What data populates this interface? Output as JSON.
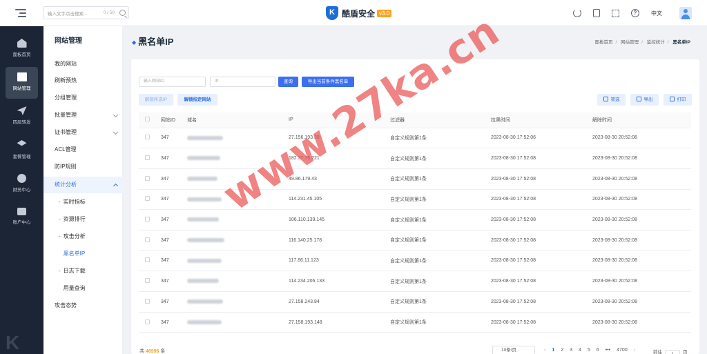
{
  "header": {
    "search_placeholder": "输入文字点击搜索...",
    "search_count": "0 / 50",
    "brand_name": "酷盾安全",
    "brand_version": "v3.0",
    "lang": "中文"
  },
  "rail": [
    {
      "label": "面板首页",
      "icon": "home-icon"
    },
    {
      "label": "网站管理",
      "icon": "site-icon"
    },
    {
      "label": "四层转发",
      "icon": "send-icon"
    },
    {
      "label": "套餐管理",
      "icon": "layers-icon"
    },
    {
      "label": "财务中心",
      "icon": "coin-icon"
    },
    {
      "label": "账户中心",
      "icon": "user-icon"
    }
  ],
  "submenu": {
    "title": "网站管理",
    "items": [
      {
        "label": "我的网站"
      },
      {
        "label": "刷新预热"
      },
      {
        "label": "分组管理"
      },
      {
        "label": "批量管理"
      },
      {
        "label": "证书管理"
      },
      {
        "label": "ACL管理"
      },
      {
        "label": "防IP规则"
      },
      {
        "label": "统计分析"
      },
      {
        "label": "实时指标"
      },
      {
        "label": "资源排行"
      },
      {
        "label": "攻击分析"
      },
      {
        "label": "黑名单IP"
      },
      {
        "label": "日志下载"
      },
      {
        "label": "用量查询"
      },
      {
        "label": "攻击态势"
      }
    ]
  },
  "page": {
    "title": "黑名单IP",
    "breadcrumb": [
      "面板首页",
      "网站管理",
      "监控统计",
      "黑名单IP"
    ]
  },
  "filters": {
    "site_id_placeholder": "输入网站ID",
    "ip_placeholder": "IP",
    "query_label": "查询",
    "export_label": "导出当前条件黑名单",
    "unblock_selected": "解锁所选IP",
    "unblock_site": "解锁指定网站",
    "filter_label": "筛选",
    "export_btn": "导出",
    "print_btn": "打印"
  },
  "table": {
    "columns": [
      "网站ID",
      "域名",
      "IP",
      "过滤器",
      "拉黑时间",
      "解除时间"
    ],
    "rows": [
      {
        "site_id": "347",
        "ip": "27.156.193.38",
        "filter": "自定义规则第1条",
        "blocked": "2023-08-30 17:52:06",
        "released": "2023-08-30 20:52:08"
      },
      {
        "site_id": "347",
        "ip": "182.37.78.221",
        "filter": "自定义规则第1条",
        "blocked": "2023-08-30 17:52:08",
        "released": "2023-08-30 20:52:08"
      },
      {
        "site_id": "347",
        "ip": "49.86.179.43",
        "filter": "自定义规则第1条",
        "blocked": "2023-08-30 17:52:08",
        "released": "2023-08-30 20:52:08"
      },
      {
        "site_id": "347",
        "ip": "114.231.45.105",
        "filter": "自定义规则第1条",
        "blocked": "2023-08-30 17:52:08",
        "released": "2023-08-30 20:52:08"
      },
      {
        "site_id": "347",
        "ip": "106.110.139.145",
        "filter": "自定义规则第1条",
        "blocked": "2023-08-30 17:52:08",
        "released": "2023-08-30 20:52:08"
      },
      {
        "site_id": "347",
        "ip": "116.140.25.178",
        "filter": "自定义规则第1条",
        "blocked": "2023-08-30 17:52:08",
        "released": "2023-08-30 20:52:08"
      },
      {
        "site_id": "347",
        "ip": "117.86.11.123",
        "filter": "自定义规则第1条",
        "blocked": "2023-08-30 17:52:08",
        "released": "2023-08-30 20:52:08"
      },
      {
        "site_id": "347",
        "ip": "114.234.206.133",
        "filter": "自定义规则第1条",
        "blocked": "2023-08-30 17:52:08",
        "released": "2023-08-30 20:52:08"
      },
      {
        "site_id": "347",
        "ip": "27.158.243.84",
        "filter": "自定义规则第1条",
        "blocked": "2023-08-30 17:52:08",
        "released": "2023-08-30 20:52:08"
      },
      {
        "site_id": "347",
        "ip": "27.158.193.148",
        "filter": "自定义规则第1条",
        "blocked": "2023-08-30 17:52:08",
        "released": "2023-08-30 20:52:08"
      }
    ]
  },
  "footer": {
    "total_prefix": "共",
    "total_count": "46996",
    "total_suffix": "条",
    "page_size": "10条/页",
    "pages": [
      "1",
      "2",
      "3",
      "4",
      "5",
      "6",
      "•••",
      "4700"
    ],
    "goto_label": "前往",
    "goto_value": "1",
    "goto_suffix": "页"
  },
  "watermark": "www.27ka.cn"
}
